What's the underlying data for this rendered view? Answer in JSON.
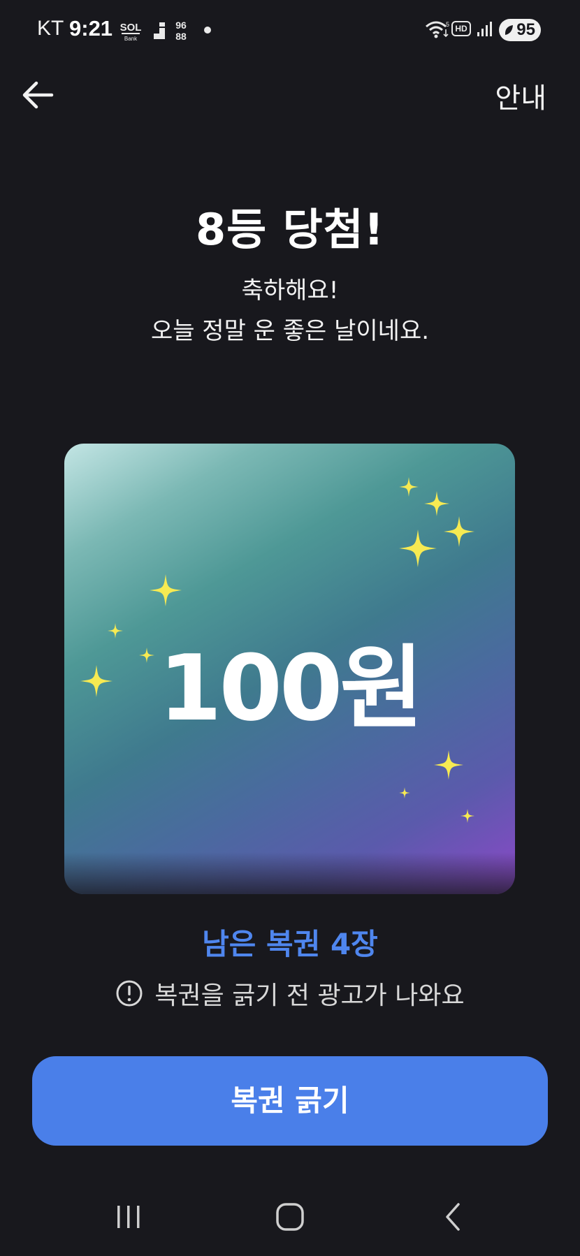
{
  "status_bar": {
    "carrier": "KT",
    "time": "9:21",
    "battery": "95",
    "hd_label": "HD"
  },
  "header": {
    "back_icon": "arrow-left-icon",
    "guide_label": "안내"
  },
  "result": {
    "title": "8등 당첨!",
    "message_line1": "축하해요!",
    "message_line2": "오늘 정말 운 좋은 날이네요."
  },
  "prize": {
    "amount": "100원",
    "sparkle_color": "#f7ea52",
    "gradient_colors": [
      "#c3e5e4",
      "#4e9896",
      "#4a6a9f",
      "#8c48c8"
    ]
  },
  "tickets": {
    "remaining_text": "남은 복권 4장",
    "ad_notice": "복권을 긁기 전 광고가 나와요",
    "accent_color": "#4f86ee"
  },
  "actions": {
    "scratch_label": "복권 긁기",
    "button_color": "#4a7fe9"
  },
  "nav": {
    "recents_icon": "recents-icon",
    "home_icon": "home-icon",
    "back_icon": "nav-back-icon"
  }
}
